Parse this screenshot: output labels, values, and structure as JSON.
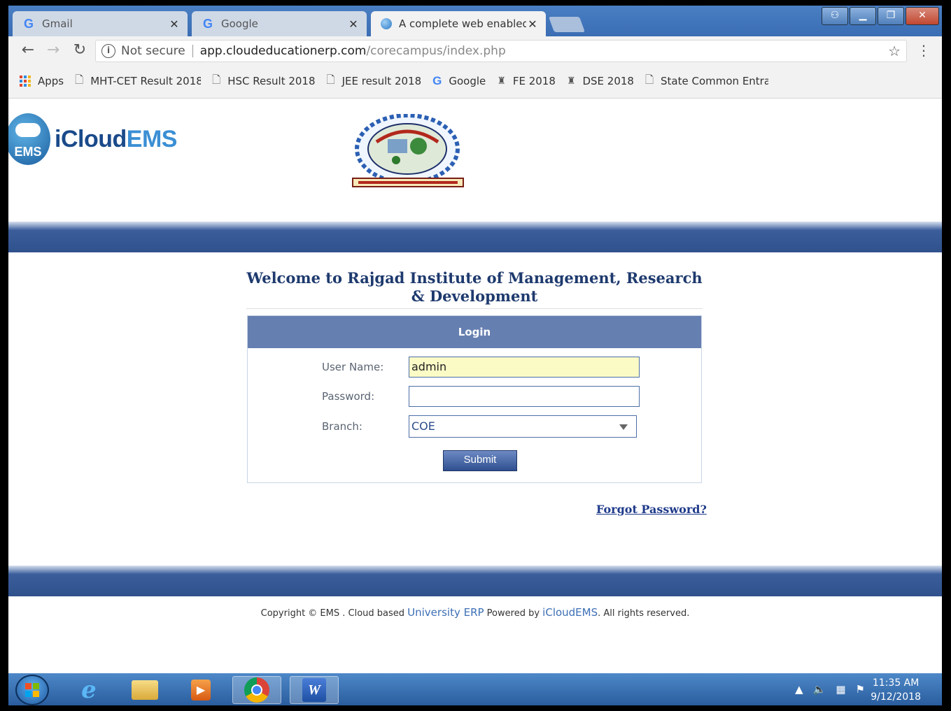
{
  "browser": {
    "tabs": [
      {
        "label": "Gmail",
        "icon": "google-icon",
        "active": false
      },
      {
        "label": "Google",
        "icon": "google-icon",
        "active": false
      },
      {
        "label": "A complete web enabled",
        "icon": "globe-icon",
        "active": true
      }
    ],
    "close_glyph": "✕",
    "address": {
      "security_label": "Not secure",
      "url_host": "app.cloudeducationerp.com",
      "url_path": "/corecampus/index.php"
    },
    "bookmarks": [
      {
        "label": "Apps",
        "icon": "apps-grid-icon"
      },
      {
        "label": "MHT-CET Result 2018",
        "icon": "page-icon"
      },
      {
        "label": "HSC Result 2018",
        "icon": "page-icon"
      },
      {
        "label": "JEE result 2018",
        "icon": "page-icon"
      },
      {
        "label": "Google",
        "icon": "google-icon"
      },
      {
        "label": "FE 2018",
        "icon": "emblem-icon"
      },
      {
        "label": "DSE 2018",
        "icon": "emblem-icon"
      },
      {
        "label": "State Common Entrance",
        "icon": "page-icon"
      }
    ]
  },
  "page": {
    "logo": {
      "brand_main": "iCloud",
      "brand_accent": "EMS",
      "badge_text": "EMS"
    },
    "welcome_title": "Welcome to Rajgad Institute of Management, Research & Development",
    "login": {
      "heading": "Login",
      "username_label": "User Name:",
      "username_value": "admin",
      "password_label": "Password:",
      "password_value": "",
      "branch_label": "Branch:",
      "branch_value": "COE",
      "submit_label": "Submit"
    },
    "forgot_password": "Forgot Password?",
    "footer": {
      "prefix": "Copyright © EMS . Cloud based ",
      "link1": "University ERP",
      "middle": " Powered by ",
      "link2": "iCloudEMS",
      "suffix": ". All rights reserved."
    }
  },
  "taskbar": {
    "apps": [
      "internet-explorer-icon",
      "file-explorer-icon",
      "media-player-icon",
      "chrome-icon",
      "word-icon"
    ],
    "clock": {
      "time": "11:35 AM",
      "date": "9/12/2018"
    }
  },
  "colors": {
    "band_blue": "#2f518c",
    "login_header": "#667fb1",
    "title_navy": "#1e3a6e",
    "input_highlight": "#fbfbc6"
  }
}
